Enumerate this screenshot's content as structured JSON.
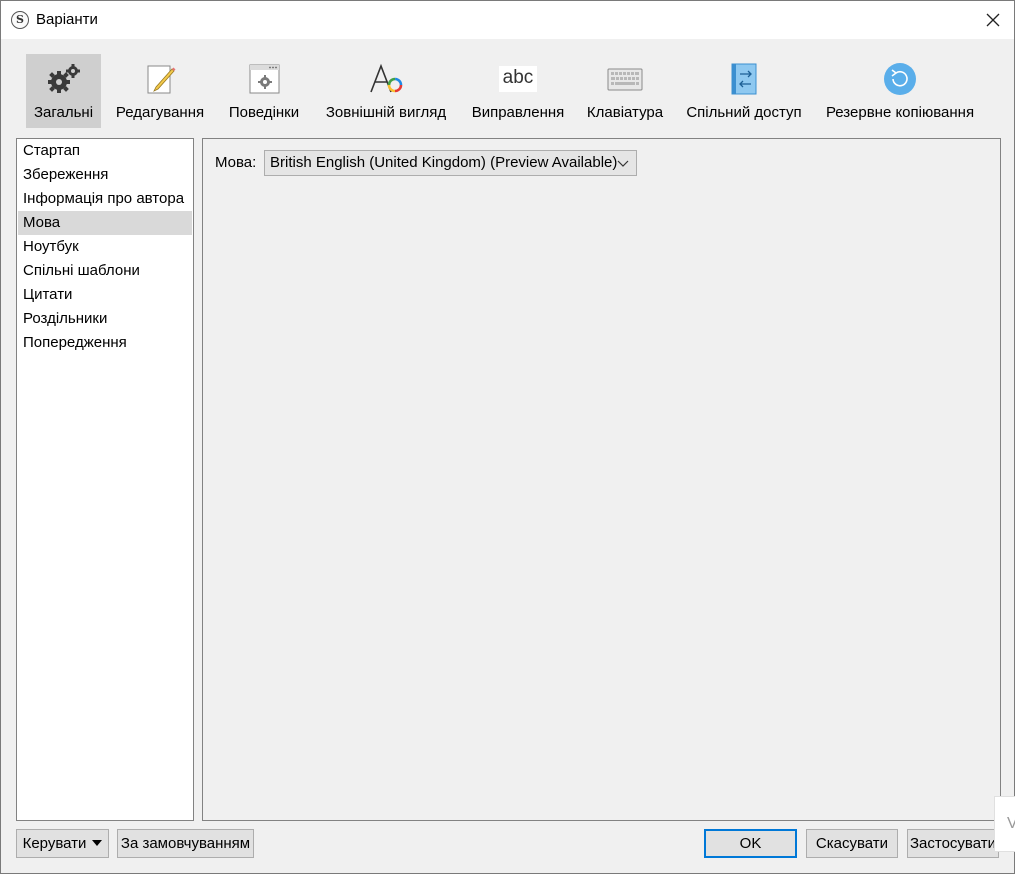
{
  "window": {
    "title": "Варіанти",
    "app_icon_letter": "S"
  },
  "toolbar": {
    "items": [
      {
        "label": "Загальні",
        "icon": "gears-icon",
        "active": true
      },
      {
        "label": "Редагування",
        "icon": "edit-pencil-icon"
      },
      {
        "label": "Поведінки",
        "icon": "behavior-window-gear-icon"
      },
      {
        "label": "Зовнішній вигляд",
        "icon": "appearance-font-icon"
      },
      {
        "label": "Виправлення",
        "icon": "spelling-abc-icon",
        "icon_text": "abc"
      },
      {
        "label": "Клавіатура",
        "icon": "keyboard-icon"
      },
      {
        "label": "Спільний доступ",
        "icon": "sharing-icon"
      },
      {
        "label": "Резервне копіювання",
        "icon": "backup-icon"
      }
    ]
  },
  "sidebar": {
    "items": [
      {
        "label": "Стартап"
      },
      {
        "label": "Збереження"
      },
      {
        "label": "Інформація про автора"
      },
      {
        "label": "Мова",
        "selected": true
      },
      {
        "label": "Ноутбук"
      },
      {
        "label": "Спільні шаблони"
      },
      {
        "label": "Цитати"
      },
      {
        "label": "Роздільники"
      },
      {
        "label": "Попередження"
      }
    ]
  },
  "panel": {
    "language_label": "Мова:",
    "language_value": "British English (United Kingdom) (Preview Available)"
  },
  "footer": {
    "manage_label": "Керувати",
    "defaults_label": "За замовчуванням",
    "ok_label": "OK",
    "cancel_label": "Скасувати",
    "apply_label": "Застосувати"
  },
  "background_fragment": {
    "text": "V"
  },
  "colors": {
    "accent": "#0078d7",
    "selected_bg": "#d9d9d9",
    "active_tab_bg": "#cfcfcf",
    "backup_icon": "#5aaeea"
  }
}
